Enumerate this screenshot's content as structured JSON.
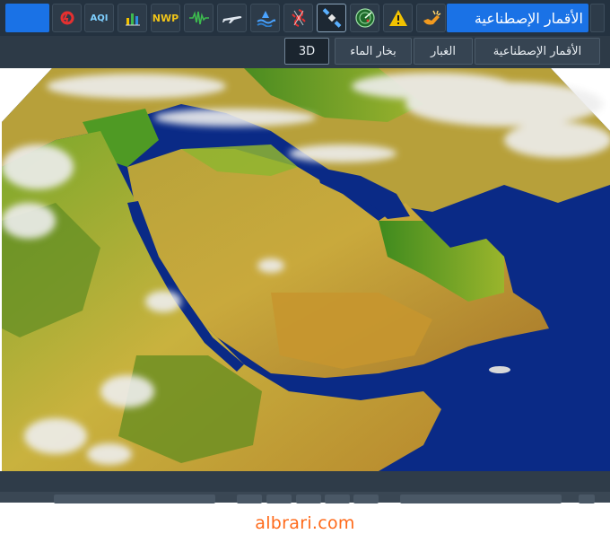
{
  "toolbar": {
    "title": "الأقمار الإصطناعية",
    "buttons": [
      {
        "name": "weather-alert-icon"
      },
      {
        "name": "warning-icon"
      },
      {
        "name": "radar-icon"
      },
      {
        "name": "satellite-icon",
        "active": true
      },
      {
        "name": "tropical-storm-icon"
      },
      {
        "name": "sea-state-icon"
      },
      {
        "name": "aviation-icon"
      },
      {
        "name": "seismic-icon"
      },
      {
        "name": "nwp-icon",
        "label": "NWP"
      },
      {
        "name": "statistics-icon"
      },
      {
        "name": "aqi-icon",
        "label": "AQI"
      },
      {
        "name": "lightning-icon"
      }
    ]
  },
  "subtabs": {
    "items": [
      {
        "label": "الأقمار الإصطناعية"
      },
      {
        "label": "الغبار"
      },
      {
        "label": "بخار الماء"
      },
      {
        "label": "3D",
        "active": true
      }
    ]
  },
  "colors": {
    "toolbar_bg": "#243240",
    "accent_blue": "#1a72e6",
    "sea": "#0a2a86",
    "watermark": "#ff6a1a"
  },
  "watermark": "albrari.com"
}
